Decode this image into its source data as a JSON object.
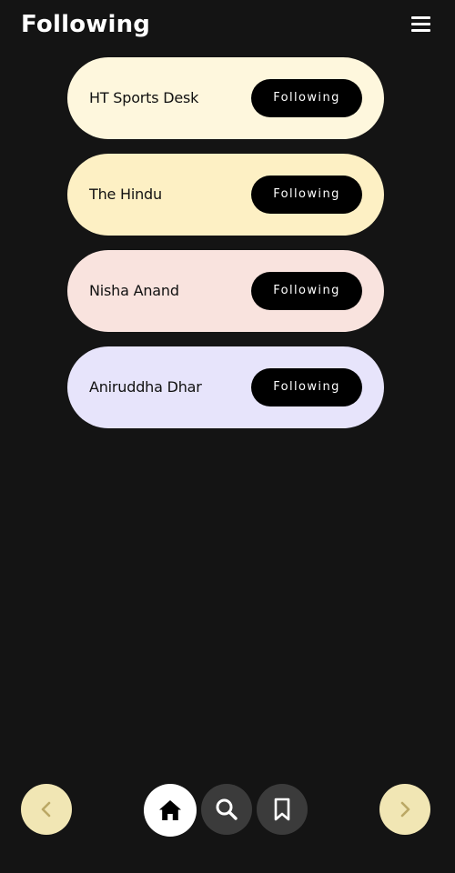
{
  "header": {
    "title": "Following",
    "menu_icon": "hamburger-menu-icon"
  },
  "following": [
    {
      "name": "HT Sports Desk",
      "button_label": "Following",
      "card_color": "#fef7dd"
    },
    {
      "name": "The Hindu",
      "button_label": "Following",
      "card_color": "#fdf0c4"
    },
    {
      "name": "Nisha Anand",
      "button_label": "Following",
      "card_color": "#f9e3de"
    },
    {
      "name": "Aniruddha Dhar",
      "button_label": "Following",
      "card_color": "#e7e4fb"
    }
  ],
  "bottom_nav": {
    "prev_icon": "chevron-left-icon",
    "home_icon": "home-icon",
    "search_icon": "search-icon",
    "bookmark_icon": "bookmark-icon",
    "next_icon": "chevron-right-icon",
    "active_item": "home"
  },
  "colors": {
    "background": "#141414",
    "arrow_button_bg": "#f1e6b4",
    "arrow_icon": "#bba865",
    "active_nav_bg": "#ffffff",
    "inactive_nav_bg": "#3b3b3b",
    "following_button_bg": "#000000"
  }
}
